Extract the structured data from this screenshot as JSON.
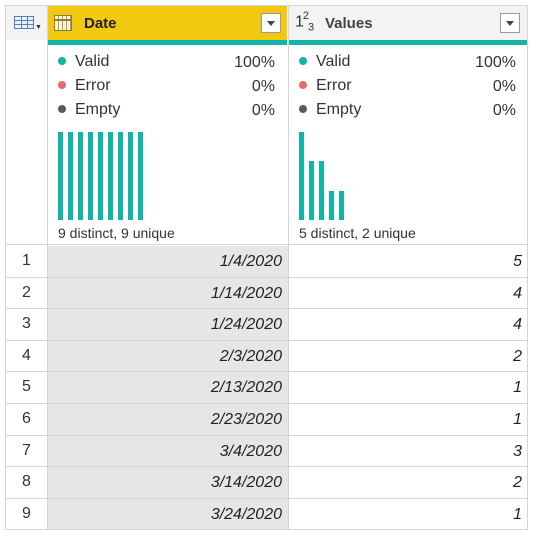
{
  "columns": [
    {
      "name": "Date",
      "type_icon": "calendar-icon",
      "quality": {
        "valid_label": "Valid",
        "valid_pct": "100%",
        "error_label": "Error",
        "error_pct": "0%",
        "empty_label": "Empty",
        "empty_pct": "0%"
      },
      "distribution": [
        1,
        1,
        1,
        1,
        1,
        1,
        1,
        1,
        1
      ],
      "summary": "9 distinct, 9 unique"
    },
    {
      "name": "Values",
      "type_icon": "number-type-icon",
      "type_glyph": {
        "a": "1",
        "b": "2",
        "c": "3"
      },
      "quality": {
        "valid_label": "Valid",
        "valid_pct": "100%",
        "error_label": "Error",
        "error_pct": "0%",
        "empty_label": "Empty",
        "empty_pct": "0%"
      },
      "distribution": [
        3,
        2,
        2,
        1,
        1
      ],
      "summary": "5 distinct, 2 unique"
    }
  ],
  "colors": {
    "valid": "#10b5a5",
    "error": "#e86a6a",
    "empty": "#5a5a5a",
    "selected_header": "#f2c811"
  },
  "rows": [
    {
      "n": "1",
      "date": "1/4/2020",
      "value": "5"
    },
    {
      "n": "2",
      "date": "1/14/2020",
      "value": "4"
    },
    {
      "n": "3",
      "date": "1/24/2020",
      "value": "4"
    },
    {
      "n": "4",
      "date": "2/3/2020",
      "value": "2"
    },
    {
      "n": "5",
      "date": "2/13/2020",
      "value": "1"
    },
    {
      "n": "6",
      "date": "2/23/2020",
      "value": "1"
    },
    {
      "n": "7",
      "date": "3/4/2020",
      "value": "3"
    },
    {
      "n": "8",
      "date": "3/14/2020",
      "value": "2"
    },
    {
      "n": "9",
      "date": "3/24/2020",
      "value": "1"
    }
  ]
}
